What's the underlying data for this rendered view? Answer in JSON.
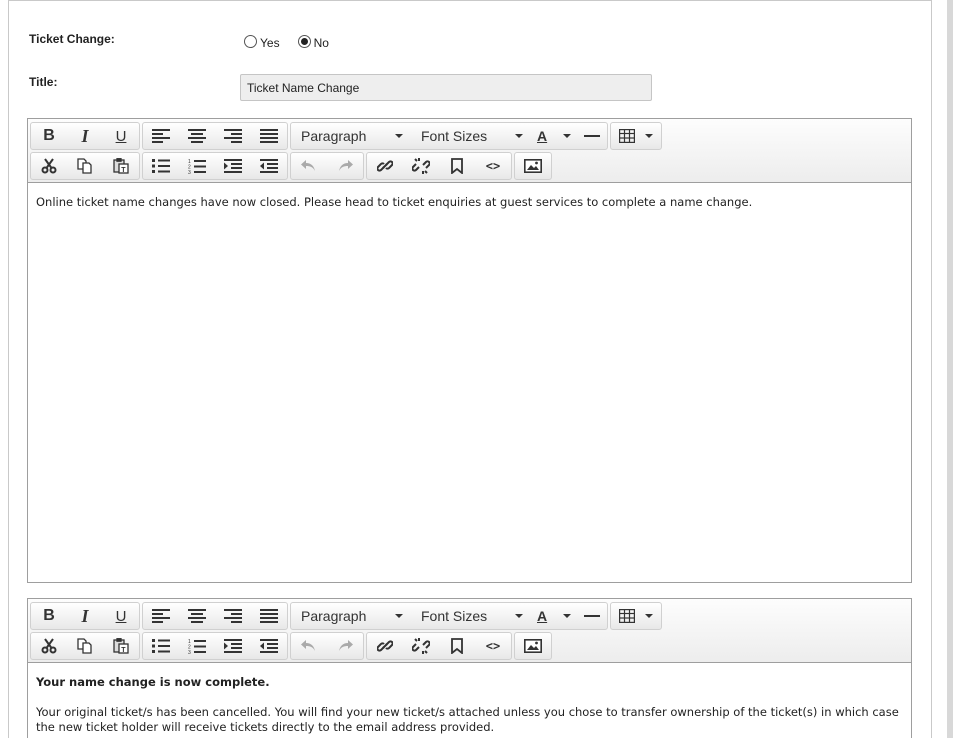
{
  "form": {
    "ticket_change_label": "Ticket Change:",
    "radio_yes": "Yes",
    "radio_no": "No",
    "selected": "No",
    "title_label": "Title:",
    "title_value": "Ticket Name Change"
  },
  "toolbar": {
    "bold": "B",
    "italic": "I",
    "underline": "U",
    "format_select": "Paragraph",
    "font_size_select": "Font Sizes",
    "text_color": "A",
    "code_view": "<>"
  },
  "editor1": {
    "content": "Online ticket name changes have now closed. Please head to ticket enquiries at guest services to complete a name change."
  },
  "editor2": {
    "heading": "Your name change is now complete.",
    "paragraph": "Your original ticket/s has been cancelled. You will find your new ticket/s attached unless you chose to transfer ownership of the ticket(s) in which case the new ticket holder will receive tickets directly to the email address provided."
  },
  "icons": [
    "bold-icon",
    "italic-icon",
    "underline-icon",
    "align-left-icon",
    "align-center-icon",
    "align-right-icon",
    "align-justify-icon",
    "text-color-icon",
    "horizontal-rule-icon",
    "table-icon",
    "cut-icon",
    "copy-icon",
    "paste-icon",
    "bullet-list-icon",
    "numbered-list-icon",
    "indent-icon",
    "outdent-icon",
    "undo-icon",
    "redo-icon",
    "link-icon",
    "unlink-icon",
    "bookmark-icon",
    "code-icon",
    "image-icon"
  ]
}
